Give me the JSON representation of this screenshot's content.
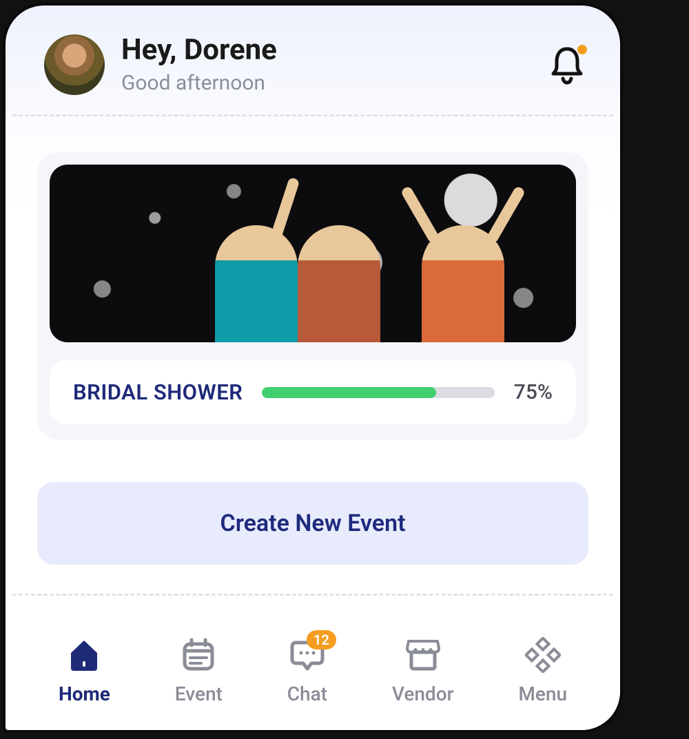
{
  "header": {
    "greeting_title": "Hey, Dorene",
    "greeting_sub": "Good afternoon",
    "notification_has_dot": true
  },
  "event_card": {
    "title": "BRIDAL SHOWER",
    "progress_percent": 75,
    "progress_label": "75%"
  },
  "create_button": {
    "label": "Create New Event"
  },
  "nav": {
    "items": [
      {
        "label": "Home",
        "icon": "home-icon",
        "active": true
      },
      {
        "label": "Event",
        "icon": "calendar-icon",
        "active": false
      },
      {
        "label": "Chat",
        "icon": "chat-icon",
        "active": false,
        "badge": "12"
      },
      {
        "label": "Vendor",
        "icon": "store-icon",
        "active": false
      },
      {
        "label": "Menu",
        "icon": "grid-icon",
        "active": false
      }
    ]
  },
  "colors": {
    "primary": "#1e2a78",
    "accent_green": "#41cf70",
    "accent_orange": "#f59d1f",
    "muted": "#8a8c97",
    "card_bg": "#f5f6f9",
    "button_bg": "#e8ebfb"
  }
}
